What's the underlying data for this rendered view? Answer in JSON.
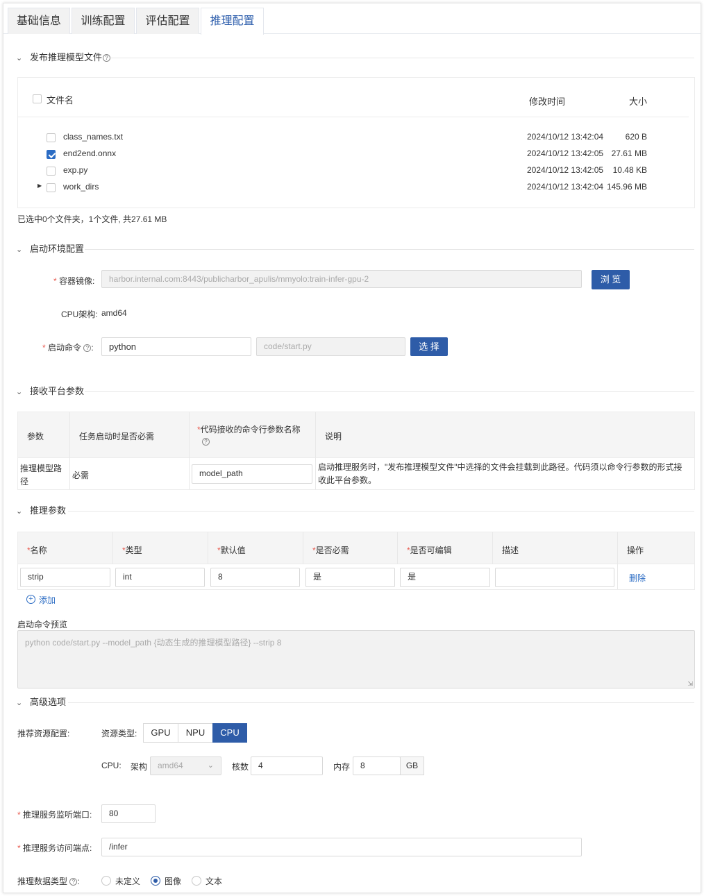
{
  "tabs": [
    "基础信息",
    "训练配置",
    "评估配置",
    "推理配置"
  ],
  "sec_publish": {
    "title": "发布推理模型文件",
    "header": {
      "name": "文件名",
      "mtime": "修改时间",
      "size": "大小"
    },
    "files": [
      {
        "name": "class_names.txt",
        "mtime": "2024/10/12 13:42:04",
        "size": "620 B",
        "checked": false
      },
      {
        "name": "end2end.onnx",
        "mtime": "2024/10/12 13:42:05",
        "size": "27.61 MB",
        "checked": true
      },
      {
        "name": "exp.py",
        "mtime": "2024/10/12 13:42:05",
        "size": "10.48 KB",
        "checked": false
      },
      {
        "name": "work_dirs",
        "mtime": "2024/10/12 13:42:04",
        "size": "145.96 MB",
        "checked": false
      }
    ],
    "summary": "已选中0个文件夹，1个文件, 共27.61 MB"
  },
  "sec_env": {
    "title": "启动环境配置",
    "image_label": "容器镜像:",
    "image_value": "harbor.internal.com:8443/publicharbor_apulis/mmyolo:train-infer-gpu-2",
    "browse": "浏 览",
    "cpu_arch_label": "CPU架构:",
    "cpu_arch_value": "amd64",
    "cmd_label": "启动命令",
    "cmd_value": "python",
    "script_placeholder": "code/start.py",
    "select": "选 择"
  },
  "sec_platform": {
    "title": "接收平台参数",
    "headers": [
      "参数",
      "任务启动时是否必需",
      "代码接收的命令行参数名称",
      "说明"
    ],
    "row": {
      "param": "推理模型路径",
      "required": "必需",
      "arg_name": "model_path",
      "desc": "启动推理服务时，\"发布推理模型文件\"中选择的文件会挂载到此路径。代码须以命令行参数的形式接收此平台参数。"
    }
  },
  "sec_infer": {
    "title": "推理参数",
    "headers": [
      "名称",
      "类型",
      "默认值",
      "是否必需",
      "是否可编辑",
      "描述",
      "操作"
    ],
    "row": {
      "name": "strip",
      "type": "int",
      "default": "8",
      "required": "是",
      "editable": "是",
      "desc": "",
      "delete": "删除"
    },
    "add": "添加",
    "preview_label": "启动命令预览",
    "preview_placeholder": "python code/start.py --model_path {动态生成的推理模型路径} --strip 8"
  },
  "sec_adv": {
    "title": "高级选项",
    "res_label": "推荐资源配置:",
    "res_type_label": "资源类型:",
    "res_types": [
      "GPU",
      "NPU",
      "CPU"
    ],
    "res_selected": "CPU",
    "cpu_label": "CPU:",
    "arch_label": "架构",
    "arch_value": "amd64",
    "cores_label": "核数",
    "cores_value": "4",
    "mem_label": "内存",
    "mem_value": "8",
    "mem_unit": "GB",
    "port_label": "推理服务监听端口:",
    "port_value": "80",
    "endpoint_label": "推理服务访问端点:",
    "endpoint_value": "/infer",
    "dtype_label": "推理数据类型",
    "dtype_options": [
      "未定义",
      "图像",
      "文本"
    ],
    "dtype_selected": "图像"
  },
  "colors": {
    "primary": "#2e5ca8",
    "required": "#e85a4f",
    "link": "#2b6cc4"
  }
}
